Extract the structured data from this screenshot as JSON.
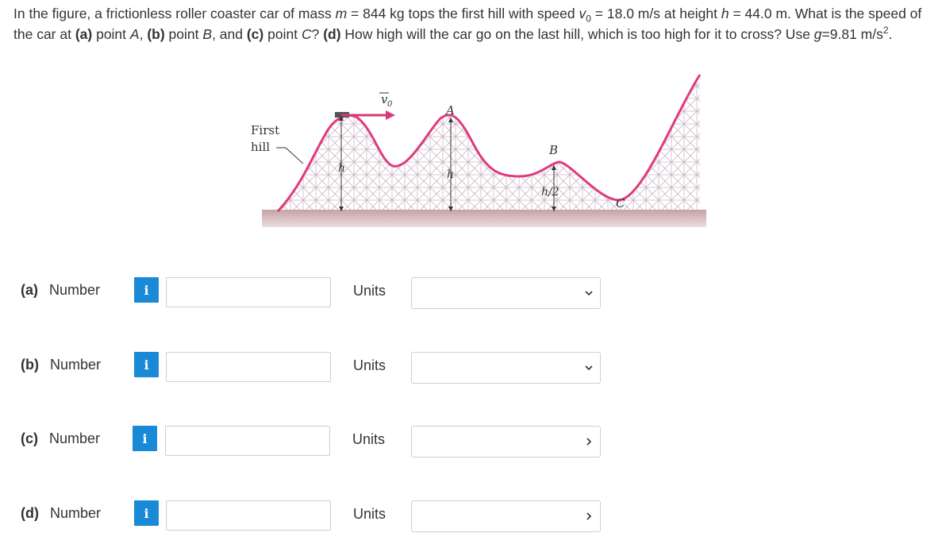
{
  "question": {
    "p1": "In the figure, a frictionless roller coaster car of mass ",
    "m_var": "m",
    "p2": " = 844 kg tops the first hill with speed ",
    "v_var": "v",
    "v_sub": "0",
    "p3": " = 18.0 m/s at height ",
    "h_var": "h",
    "p4": " = 44.0 m. What is the speed of the car at ",
    "a": "(a)",
    "p5": " point ",
    "A": "A",
    "p6": ", ",
    "b": "(b)",
    "p7": " point ",
    "B": "B",
    "p8": ", and ",
    "c": "(c)",
    "p9": " point ",
    "C": "C",
    "p10": "? ",
    "d": "(d)",
    "p11": " How high will the car go on the last hill, which is too high for it to cross? Use ",
    "g_var": "g",
    "p12": "=9.81 m/s",
    "g_sup": "2",
    "p13": "."
  },
  "figure": {
    "first_hill": "First",
    "first_hill_2": "hill",
    "v0": "v",
    "v0_sub": "0",
    "label_A": "A",
    "label_B": "B",
    "label_C": "C",
    "label_h1": "h",
    "label_h2": "h",
    "label_h_half": "h/2"
  },
  "parts": [
    {
      "letter": "(a)",
      "number_label": "Number",
      "info": "i",
      "number_value": "",
      "units_label": "Units",
      "units_value": ""
    },
    {
      "letter": "(b)",
      "number_label": "Number",
      "info": "i",
      "number_value": "",
      "units_label": "Units",
      "units_value": ""
    },
    {
      "letter": "(c)",
      "number_label": "Number",
      "info": "i",
      "number_value": "",
      "units_label": "Units",
      "units_value": ""
    },
    {
      "letter": "(d)",
      "number_label": "Number",
      "info": "i",
      "number_value": "",
      "units_label": "Units",
      "units_value": ""
    }
  ],
  "colors": {
    "info_button": "#1a8ad6",
    "track": "#e0397f",
    "scaffold": "#c9b6c4",
    "ground": "#c9a9a9",
    "velocity_arrow": "#d63a7a"
  },
  "icons": {
    "info": "info-icon",
    "dropdown": "chevron-down-icon"
  }
}
